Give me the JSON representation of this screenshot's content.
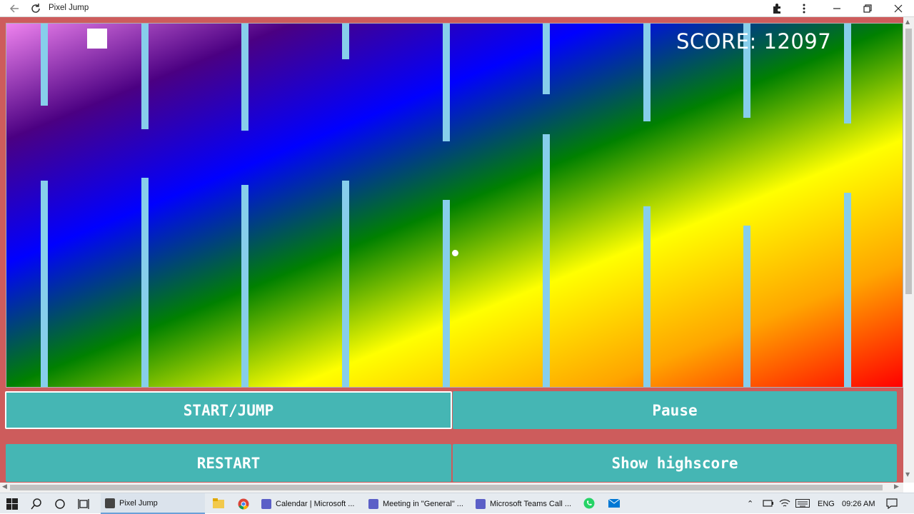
{
  "browser": {
    "title": "Pixel Jump"
  },
  "game": {
    "score_label": "SCORE: 12097",
    "pillar_color": "#87ceeb",
    "background_gradient": [
      "violet",
      "indigo",
      "blue",
      "green",
      "yellow",
      "orange",
      "red"
    ]
  },
  "controls": {
    "start_label": "START/JUMP",
    "pause_label": "Pause",
    "restart_label": "RESTART",
    "highscore_label": "Show highscore"
  },
  "taskbar": {
    "items": [
      {
        "label": "Pixel Jump",
        "active": true
      },
      {
        "label": "Calendar | Microsoft ..."
      },
      {
        "label": "Meeting in \"General\" ..."
      },
      {
        "label": "Microsoft Teams Call ..."
      }
    ],
    "language": "ENG",
    "time": "09:26 AM"
  },
  "colors": {
    "page_background": "#cd5c5c",
    "button": "#45b6b4",
    "button_text": "#ffffff"
  }
}
